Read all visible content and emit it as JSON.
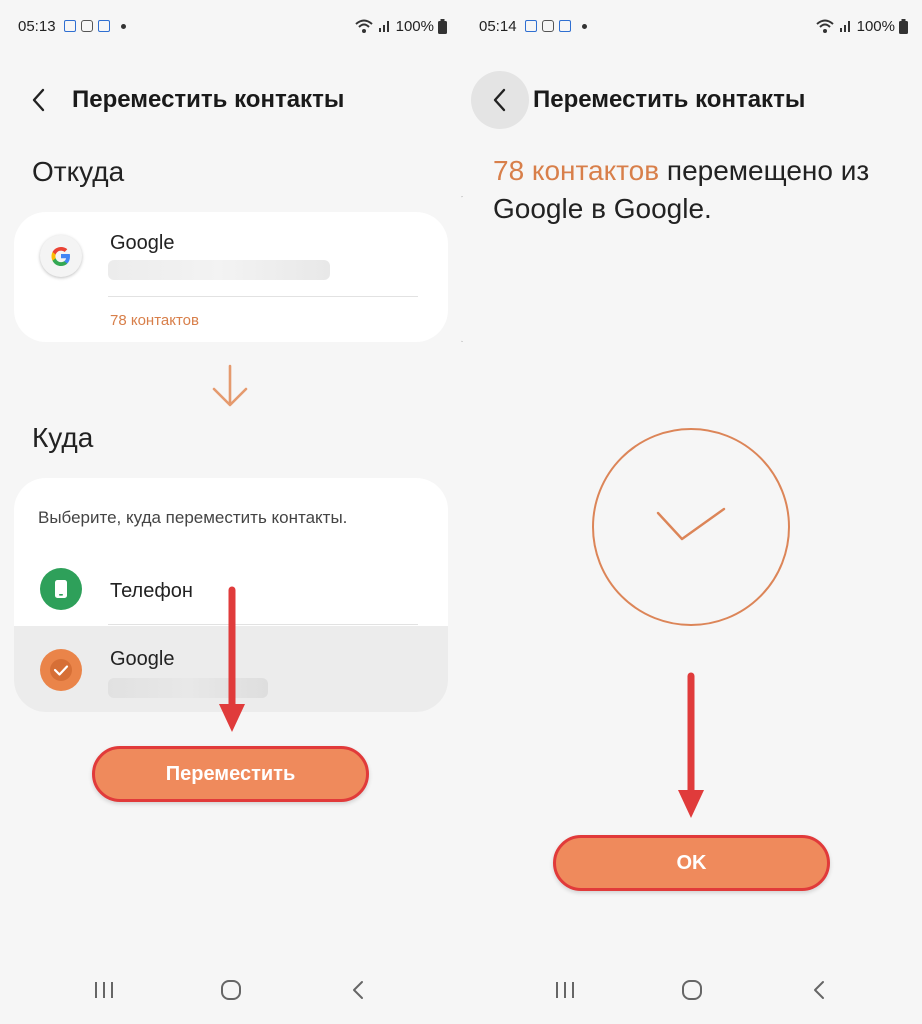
{
  "colors": {
    "accent": "#ef8a5c",
    "accent_text": "#d87f4a",
    "highlight_outline": "#e13a3a",
    "phone_green": "#2ea05a"
  },
  "left": {
    "status": {
      "time": "05:13",
      "battery": "100%"
    },
    "title": "Переместить контакты",
    "from_label": "Откуда",
    "source": {
      "icon": "google-g-icon",
      "name": "Google",
      "count": "78 контактов"
    },
    "to_label": "Куда",
    "hint": "Выберите, куда переместить контакты.",
    "options": [
      {
        "icon": "phone-icon",
        "name": "Телефон"
      },
      {
        "icon": "check-icon",
        "name": "Google",
        "selected": true
      }
    ],
    "move_button": "Переместить"
  },
  "right": {
    "status": {
      "time": "05:14",
      "battery": "100%"
    },
    "title": "Переместить контакты",
    "result_count": "78 контактов",
    "result_rest": " перемещено из Google в Google.",
    "ok_button": "OK"
  }
}
